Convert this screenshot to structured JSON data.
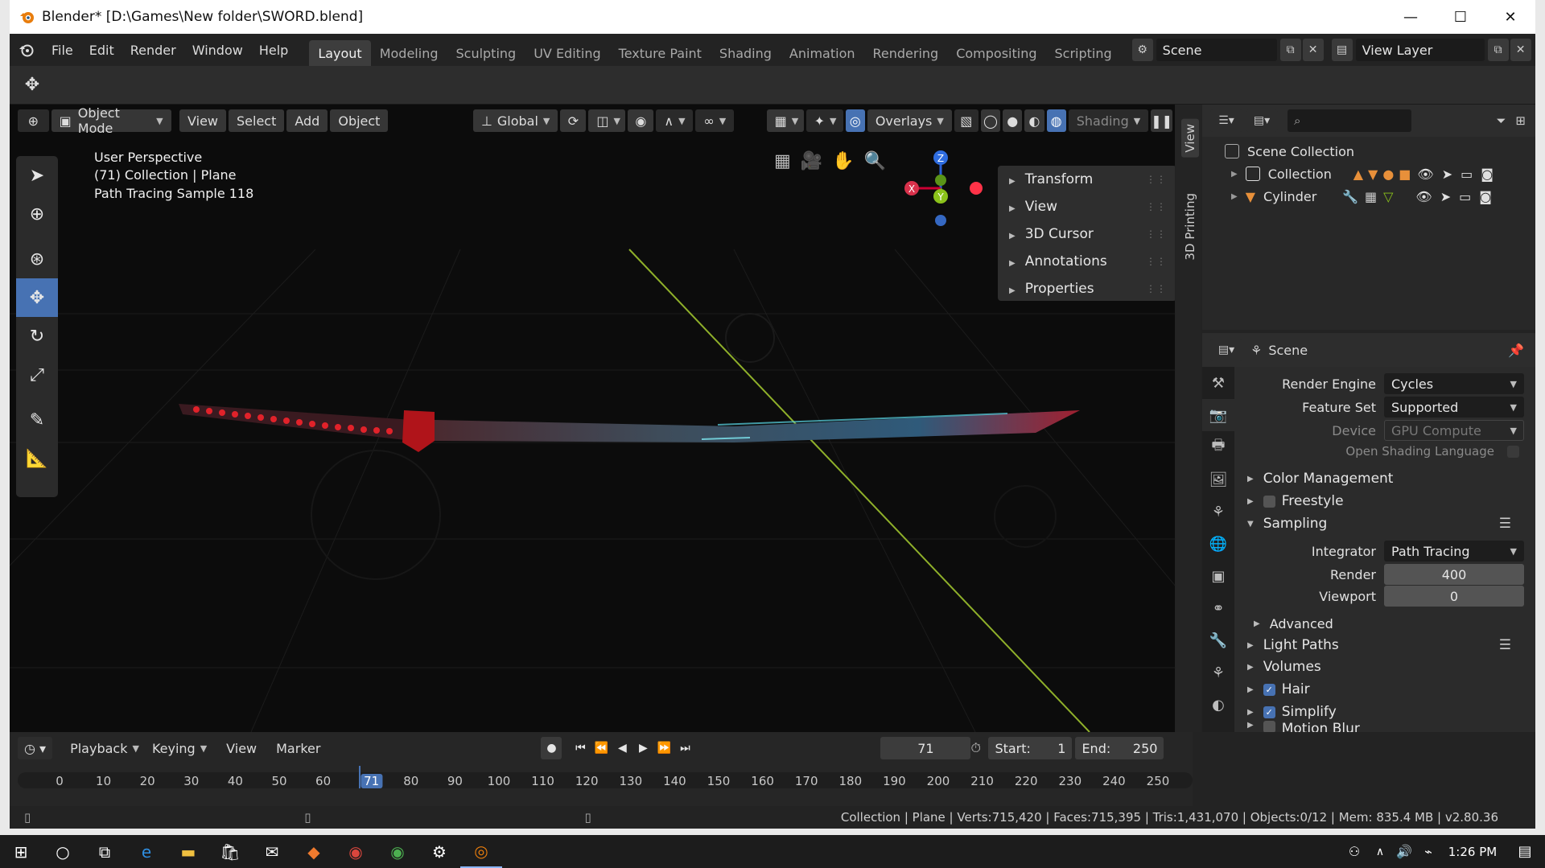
{
  "window": {
    "title": "Blender* [D:\\Games\\New folder\\SWORD.blend]",
    "minimize": "—",
    "maximize": "☐",
    "close": "✕"
  },
  "menu": {
    "items": [
      "File",
      "Edit",
      "Render",
      "Window",
      "Help"
    ],
    "workspaces": [
      "Layout",
      "Modeling",
      "Sculpting",
      "UV Editing",
      "Texture Paint",
      "Shading",
      "Animation",
      "Rendering",
      "Compositing",
      "Scripting"
    ],
    "active_workspace": "Layout",
    "scene_name": "Scene",
    "view_layer": "View Layer"
  },
  "viewport_header": {
    "mode": "Object Mode",
    "menus": [
      "View",
      "Select",
      "Add",
      "Object"
    ],
    "transform_orientation": "Global",
    "overlays": "Overlays",
    "shading": "Shading"
  },
  "viewport": {
    "info_line1": "User Perspective",
    "info_line2": "(71) Collection | Plane",
    "info_line3": "Path Tracing Sample 118",
    "gizmo_labels": {
      "z": "Z",
      "y": "Y",
      "x": "X"
    }
  },
  "npanel": {
    "items": [
      "Transform",
      "View",
      "3D Cursor",
      "Annotations",
      "Properties"
    ],
    "tabs": [
      "View",
      "3D Printing"
    ]
  },
  "outliner": {
    "root": "Scene Collection",
    "rows": [
      {
        "name": "Collection"
      },
      {
        "name": "Cylinder"
      }
    ]
  },
  "properties": {
    "header": "Scene",
    "render_engine_label": "Render Engine",
    "render_engine": "Cycles",
    "feature_set_label": "Feature Set",
    "feature_set": "Supported",
    "device_label": "Device",
    "device": "GPU Compute",
    "osl_label": "Open Shading Language",
    "sections": {
      "color_management": "Color Management",
      "freestyle": "Freestyle",
      "sampling": "Sampling",
      "advanced": "Advanced",
      "light_paths": "Light Paths",
      "volumes": "Volumes",
      "hair": "Hair",
      "simplify": "Simplify",
      "motion_blur": "Motion Blur"
    },
    "integrator_label": "Integrator",
    "integrator": "Path Tracing",
    "render_label": "Render",
    "render_samples": "400",
    "viewport_label": "Viewport",
    "viewport_samples": "0"
  },
  "timeline": {
    "menus": [
      "Playback",
      "Keying",
      "View",
      "Marker"
    ],
    "current_frame": "71",
    "start_label": "Start:",
    "start": "1",
    "end_label": "End:",
    "end": "250",
    "ticks": [
      "0",
      "10",
      "20",
      "30",
      "40",
      "50",
      "60",
      "71",
      "80",
      "90",
      "100",
      "110",
      "120",
      "130",
      "140",
      "150",
      "160",
      "170",
      "180",
      "190",
      "200",
      "210",
      "220",
      "230",
      "240",
      "250"
    ]
  },
  "statusbar": {
    "stats": "Collection | Plane | Verts:715,420 | Faces:715,395 | Tris:1,431,070 | Objects:0/12 | Mem: 835.4 MB | v2.80.36"
  },
  "taskbar": {
    "time": "1:26 PM"
  },
  "colors": {
    "accent": "#4772b3",
    "blade_cyan": "#5ad6e6",
    "guard_red": "#c0141a",
    "axis_green": "#9cbf2a"
  }
}
